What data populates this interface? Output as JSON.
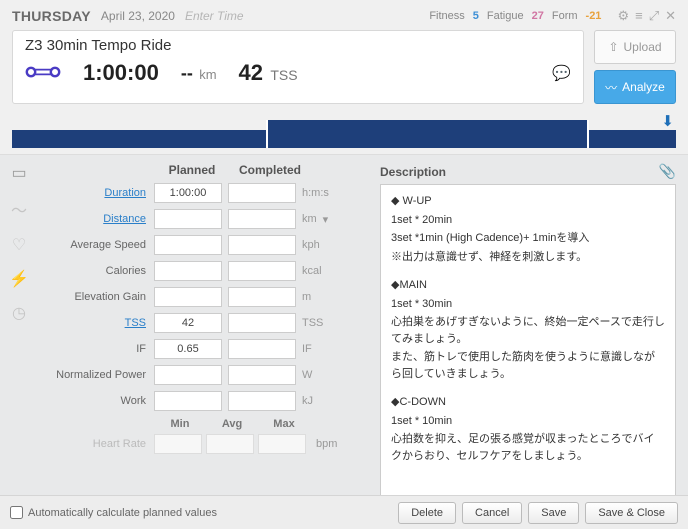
{
  "header": {
    "day": "THURSDAY",
    "date": "April 23, 2020",
    "enter_time": "Enter Time",
    "fitness_lbl": "Fitness",
    "fitness_val": "5",
    "fatigue_lbl": "Fatigue",
    "fatigue_val": "27",
    "form_lbl": "Form",
    "form_val": "-21"
  },
  "card": {
    "title": "Z3 30min Tempo Ride",
    "duration": "1:00:00",
    "distance_dash": "--",
    "distance_unit": "km",
    "tss_val": "42",
    "tss_lbl": "TSS"
  },
  "buttons": {
    "upload": "Upload",
    "analyze": "Analyze"
  },
  "plan": {
    "col_planned": "Planned",
    "col_completed": "Completed",
    "rows": {
      "duration_lbl": "Duration",
      "duration_val": "1:00:00",
      "duration_unit": "h:m:s",
      "distance_lbl": "Distance",
      "distance_unit": "km",
      "avgspeed_lbl": "Average Speed",
      "avgspeed_unit": "kph",
      "calories_lbl": "Calories",
      "calories_unit": "kcal",
      "elev_lbl": "Elevation Gain",
      "elev_unit": "m",
      "tss_lbl": "TSS",
      "tss_val": "42",
      "tss_unit": "TSS",
      "if_lbl": "IF",
      "if_val": "0.65",
      "if_unit": "IF",
      "np_lbl": "Normalized Power",
      "np_unit": "W",
      "work_lbl": "Work",
      "work_unit": "kJ"
    },
    "sub": {
      "min": "Min",
      "avg": "Avg",
      "max": "Max",
      "hr_lbl": "Heart Rate",
      "hr_unit": "bpm"
    }
  },
  "desc": {
    "title": "Description",
    "l1": "◆ W-UP",
    "l2": "1set * 20min",
    "l3": "3set *1min (High Cadence)+ 1minを導入",
    "l4": "※出力は意識せず、神経を刺激します。",
    "l5": "◆MAIN",
    "l6": "1set * 30min",
    "l7": "心拍巣をあげすぎないように、終始一定ペースで走行してみましょう。",
    "l8": "また、筋トレで使用した筋肉を使うように意識しながら回していきましょう。",
    "l9": "◆C-DOWN",
    "l10": "1set * 10min",
    "l11": "心拍数を抑え、足の張る感覚が収まったところでバイクからおり、セルフケアをしましょう。"
  },
  "footer": {
    "auto_calc": "Automatically calculate planned values",
    "delete": "Delete",
    "cancel": "Cancel",
    "save": "Save",
    "save_close": "Save & Close"
  }
}
